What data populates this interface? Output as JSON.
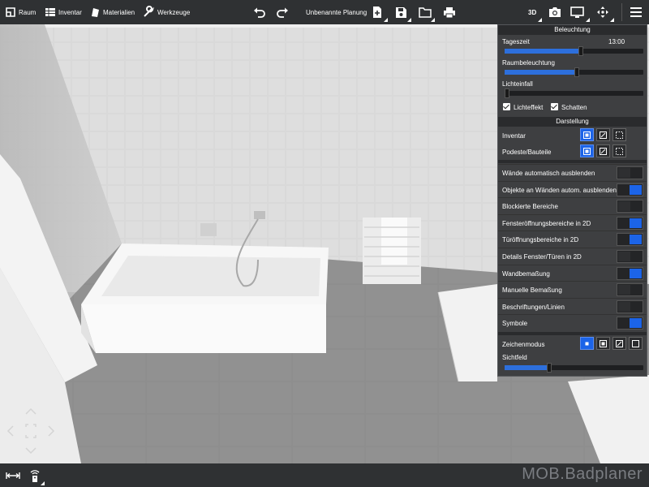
{
  "toolbar": {
    "room_label": "Raum",
    "inventory_label": "Inventar",
    "materials_label": "Materialien",
    "tools_label": "Werkzeuge",
    "plan_title": "Unbenannte Planung",
    "view_mode": "3D",
    "icons": [
      "room-icon",
      "inventory-icon",
      "materials-icon",
      "tools-icon",
      "undo-icon",
      "redo-icon",
      "add-plan-icon",
      "save-icon",
      "folder-icon",
      "print-icon",
      "camera-icon",
      "monitor-icon",
      "move-icon",
      "hamburger-menu-icon"
    ]
  },
  "panel": {
    "lighting": {
      "title": "Beleuchtung",
      "time_label": "Tageszeit",
      "time_value": "13:00",
      "time_fraction": 0.55,
      "room_light_label": "Raumbeleuchtung",
      "room_light_fraction": 0.52,
      "light_incidence_label": "Lichteinfall",
      "light_incidence_fraction": 0.0,
      "light_effect_label": "Lichteffekt",
      "light_effect_checked": true,
      "shadow_label": "Schatten",
      "shadow_checked": true
    },
    "display": {
      "title": "Darstellung",
      "inventory_label": "Inventar",
      "podest_label": "Podeste/Bauteile",
      "toggles": [
        {
          "label": "Wände automatisch ausblenden",
          "on": false
        },
        {
          "label": "Objekte an Wänden autom. ausblenden",
          "on": true
        },
        {
          "label": "Blockierte Bereiche",
          "on": false
        },
        {
          "label": "Fensteröffnungsbereiche in 2D",
          "on": true
        },
        {
          "label": "Türöffnungsbereiche in 2D",
          "on": true
        },
        {
          "label": "Details Fenster/Türen in 2D",
          "on": false
        },
        {
          "label": "Wandbemaßung",
          "on": true
        },
        {
          "label": "Manuelle Bemaßung",
          "on": false
        },
        {
          "label": "Beschriftungen/Linien",
          "on": false
        },
        {
          "label": "Symbole",
          "on": true
        }
      ],
      "draw_mode_label": "Zeichenmodus",
      "field_of_view_label": "Sichtfeld",
      "field_of_view_fraction": 0.32
    }
  },
  "brand": "MOB.Badplaner",
  "colors": {
    "accent": "#1c64e8",
    "toolbar": "#2f3133",
    "panel": "#3e3f41"
  }
}
